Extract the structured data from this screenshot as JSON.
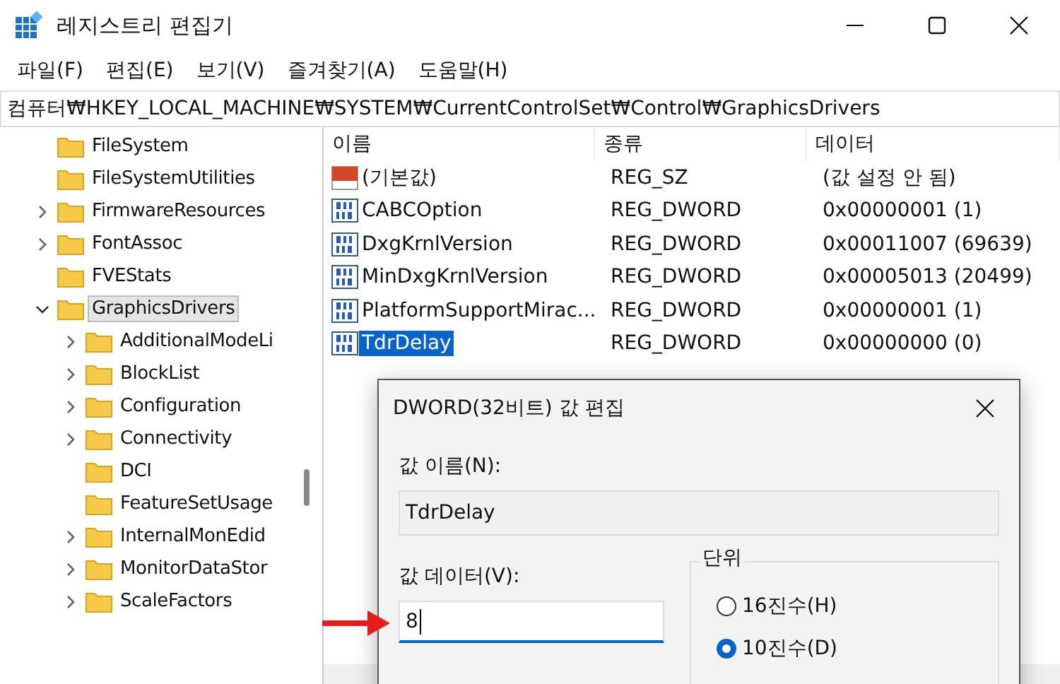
{
  "window": {
    "title": "레지스트리 편집기"
  },
  "menu": [
    "파일(F)",
    "편집(E)",
    "보기(V)",
    "즐겨찾기(A)",
    "도움말(H)"
  ],
  "address": "컴퓨터₩HKEY_LOCAL_MACHINE₩SYSTEM₩CurrentControlSet₩Control₩GraphicsDrivers",
  "tree": [
    {
      "name": "FileSystem",
      "kind": "leaf",
      "selected": false
    },
    {
      "name": "FileSystemUtilities",
      "kind": "leaf",
      "selected": false
    },
    {
      "name": "FirmwareResources",
      "kind": "collapsed",
      "selected": false
    },
    {
      "name": "FontAssoc",
      "kind": "collapsed",
      "selected": false
    },
    {
      "name": "FVEStats",
      "kind": "leaf",
      "selected": false
    },
    {
      "name": "GraphicsDrivers",
      "kind": "expanded",
      "selected": true,
      "children": [
        {
          "name": "AdditionalModeLi",
          "kind": "collapsed",
          "selected": false
        },
        {
          "name": "BlockList",
          "kind": "collapsed",
          "selected": false
        },
        {
          "name": "Configuration",
          "kind": "collapsed",
          "selected": false
        },
        {
          "name": "Connectivity",
          "kind": "collapsed",
          "selected": false
        },
        {
          "name": "DCI",
          "kind": "leaf",
          "selected": false
        },
        {
          "name": "FeatureSetUsage",
          "kind": "leaf",
          "selected": false
        },
        {
          "name": "InternalMonEdid",
          "kind": "collapsed",
          "selected": false
        },
        {
          "name": "MonitorDataStor",
          "kind": "collapsed",
          "selected": false
        },
        {
          "name": "ScaleFactors",
          "kind": "collapsed",
          "selected": false
        }
      ]
    }
  ],
  "table": {
    "columns": [
      "이름",
      "종류",
      "데이터"
    ],
    "rows": [
      {
        "kind": "string",
        "name": "(기본값)",
        "type": "REG_SZ",
        "data": "(값 설정 안 됨)",
        "selected": false
      },
      {
        "kind": "dword",
        "name": "CABCOption",
        "type": "REG_DWORD",
        "data": "0x00000001 (1)",
        "selected": false
      },
      {
        "kind": "dword",
        "name": "DxgKrnlVersion",
        "type": "REG_DWORD",
        "data": "0x00011007 (69639)",
        "selected": false
      },
      {
        "kind": "dword",
        "name": "MinDxgKrnlVersion",
        "type": "REG_DWORD",
        "data": "0x00005013 (20499)",
        "selected": false
      },
      {
        "kind": "dword",
        "name": "PlatformSupportMirac...",
        "type": "REG_DWORD",
        "data": "0x00000001 (1)",
        "selected": false
      },
      {
        "kind": "dword",
        "name": "TdrDelay",
        "type": "REG_DWORD",
        "data": "0x00000000 (0)",
        "selected": true
      }
    ]
  },
  "dialog": {
    "title": "DWORD(32비트) 값 편집",
    "name_label": "값 이름(N):",
    "name_value": "TdrDelay",
    "data_label": "값 데이터(V):",
    "data_value": "8",
    "unit_label": "단위",
    "radios": [
      {
        "label": "16진수(H)",
        "selected": false
      },
      {
        "label": "10진수(D)",
        "selected": true
      }
    ]
  }
}
